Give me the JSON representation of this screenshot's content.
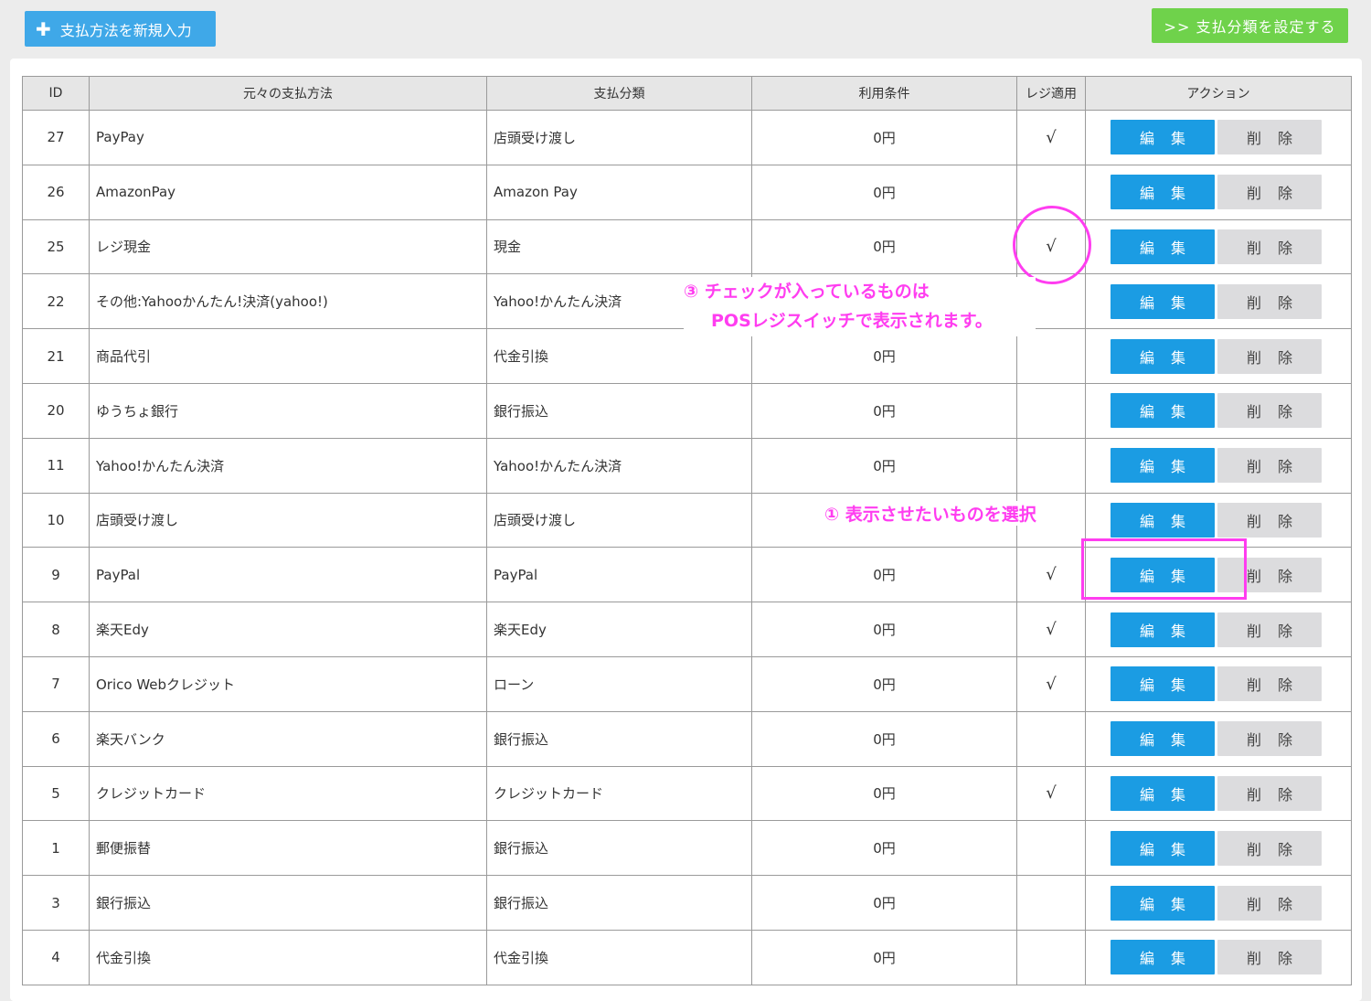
{
  "toolbar": {
    "new_button_label": "支払方法を新規入力",
    "category_button_label": ">> 支払分類を設定する"
  },
  "table": {
    "headers": {
      "id": "ID",
      "original": "元々の支払方法",
      "category": "支払分類",
      "condition": "利用条件",
      "pos": "レジ適用",
      "action": "アクション"
    },
    "edit_label": "編集",
    "delete_label": "削除",
    "check_mark": "√",
    "rows": [
      {
        "id": "27",
        "name": "PayPay",
        "category": "店頭受け渡し",
        "condition": "0円",
        "pos": "√"
      },
      {
        "id": "26",
        "name": "AmazonPay",
        "category": "Amazon Pay",
        "condition": "0円",
        "pos": ""
      },
      {
        "id": "25",
        "name": "レジ現金",
        "category": "現金",
        "condition": "0円",
        "pos": "√"
      },
      {
        "id": "22",
        "name": "その他:Yahooかんたん!決済(yahoo!)",
        "category": "Yahoo!かんたん決済",
        "condition": "",
        "pos": ""
      },
      {
        "id": "21",
        "name": "商品代引",
        "category": "代金引換",
        "condition": "0円",
        "pos": ""
      },
      {
        "id": "20",
        "name": "ゆうちょ銀行",
        "category": "銀行振込",
        "condition": "0円",
        "pos": ""
      },
      {
        "id": "11",
        "name": "Yahoo!かんたん決済",
        "category": "Yahoo!かんたん決済",
        "condition": "0円",
        "pos": ""
      },
      {
        "id": "10",
        "name": "店頭受け渡し",
        "category": "店頭受け渡し",
        "condition": "",
        "pos": ""
      },
      {
        "id": "9",
        "name": "PayPal",
        "category": "PayPal",
        "condition": "0円",
        "pos": "√"
      },
      {
        "id": "8",
        "name": "楽天Edy",
        "category": "楽天Edy",
        "condition": "0円",
        "pos": "√"
      },
      {
        "id": "7",
        "name": "Orico Webクレジット",
        "category": "ローン",
        "condition": "0円",
        "pos": "√"
      },
      {
        "id": "6",
        "name": "楽天バンク",
        "category": "銀行振込",
        "condition": "0円",
        "pos": ""
      },
      {
        "id": "5",
        "name": "クレジットカード",
        "category": "クレジットカード",
        "condition": "0円",
        "pos": "√"
      },
      {
        "id": "1",
        "name": "郵便振替",
        "category": "銀行振込",
        "condition": "0円",
        "pos": ""
      },
      {
        "id": "3",
        "name": "銀行振込",
        "category": "銀行振込",
        "condition": "0円",
        "pos": ""
      },
      {
        "id": "4",
        "name": "代金引換",
        "category": "代金引換",
        "condition": "0円",
        "pos": ""
      }
    ]
  },
  "annotations": {
    "note3_line1": "③ チェックが入っているものは",
    "note3_line2": "POSレジスイッチで表示されます。",
    "note1": "① 表示させたいものを選択",
    "color": "#ff3df0"
  },
  "colors": {
    "new_button": "#3fa8e8",
    "category_button": "#6fd24b",
    "edit_button": "#1b9ce3",
    "delete_button": "#dcdcde"
  }
}
